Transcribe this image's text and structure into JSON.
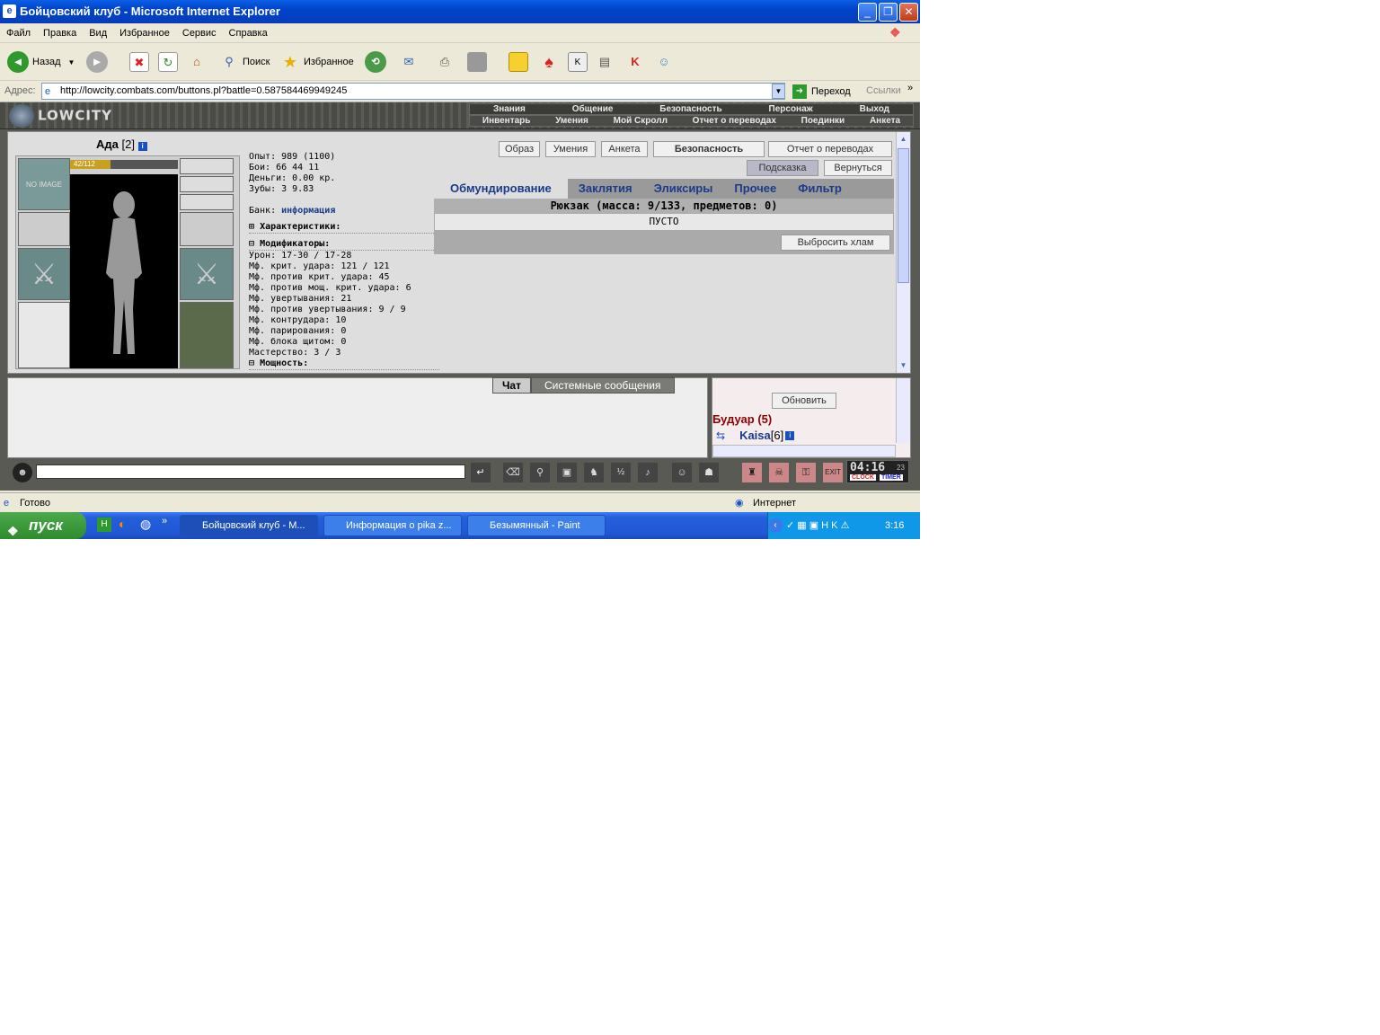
{
  "window": {
    "title": "Бойцовский клуб - Microsoft Internet Explorer"
  },
  "menu": [
    "Файл",
    "Правка",
    "Вид",
    "Избранное",
    "Сервис",
    "Справка"
  ],
  "toolbar": {
    "back": "Назад",
    "search": "Поиск",
    "favorites": "Избранное"
  },
  "address": {
    "label": "Адрес:",
    "url": "http://lowcity.combats.com/buttons.pl?battle=0.587584469949245",
    "go": "Переход",
    "links": "Ссылки"
  },
  "site": {
    "logo": "LOWCITY",
    "nav_top": [
      "Знания",
      "Общение",
      "Безопасность",
      "Персонаж",
      "Выход"
    ],
    "nav_bottom": [
      "Инвентарь",
      "Умения",
      "Мой Скролл",
      "Отчет о переводах",
      "Поединки",
      "Анкета"
    ]
  },
  "character": {
    "name": "Ада",
    "level": "[2]",
    "hp": "42/112",
    "hp_fraction": 0.375,
    "no_image": "NO IMAGE"
  },
  "stats": {
    "exp": "Опыт: 989 (1100)",
    "fights": "Бои:   66    44    11",
    "money": "Деньги: 0.00 кр.",
    "teeth": "Зубы:  3  9.83",
    "bank_label": "Банк:",
    "bank_link": "информация",
    "characteristics": "Характеристики:",
    "modifiers": "Модификаторы:",
    "lines": [
      "Урон: 17-30 / 17-28",
      "Мф. крит. удара: 121 / 121",
      "Мф. против крит. удара: 45",
      "Мф. против мощ. крит. удара: 6",
      "Мф. увертывания: 21",
      "Мф. против увертывания: 9 / 9",
      "Мф. контрудара: 10",
      "Мф. парирования: 0",
      "Мф. блока щитом: 0",
      "Мастерство: 3 / 3"
    ],
    "power": "Мощность:"
  },
  "buttons": {
    "obraz": "Образ",
    "skills": "Умения",
    "anketa": "Анкета",
    "security": "Безопасность",
    "report": "Отчет о переводах",
    "hint": "Подсказка",
    "back": "Вернуться",
    "drop": "Выбросить хлам"
  },
  "tabs": [
    "Обмундирование",
    "Заклятия",
    "Эликсиры",
    "Прочее",
    "Фильтр"
  ],
  "backpack": {
    "title": "Рюкзак (масса: 9/133, предметов: 0)",
    "empty": "ПУСТО"
  },
  "chat": {
    "tab_chat": "Чат",
    "tab_system": "Системные сообщения",
    "refresh": "Обновить",
    "room": "Будуар (5)",
    "user": "Kaisa",
    "user_level": "[6]"
  },
  "clock": {
    "time": "04:16",
    "sec": "23",
    "clock_label": "CLOCK",
    "timer_label": "TIMER"
  },
  "status": {
    "ready": "Готово",
    "zone": "Интернет"
  },
  "taskbar": {
    "start": "пуск",
    "tasks": [
      "Бойцовский клуб - M...",
      "Информация о pika z...",
      "Безымянный - Paint"
    ],
    "time": "3:16"
  },
  "colors": {
    "xp_blue": "#0143c8",
    "link": "#1a3a8a",
    "room": "#8b0000"
  }
}
